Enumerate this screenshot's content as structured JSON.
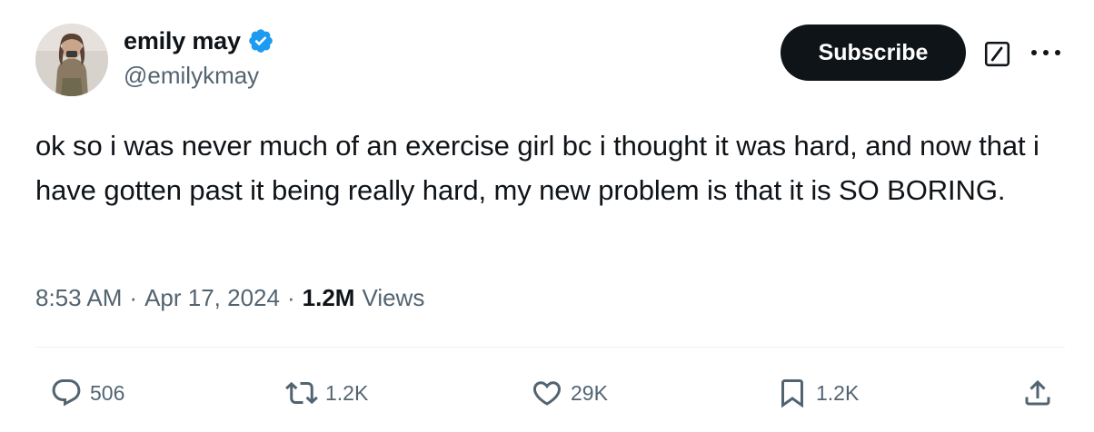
{
  "user": {
    "display_name": "emily may",
    "handle": "@emilykmay",
    "verified_icon": "verified-badge-icon",
    "avatar": "profile-photo"
  },
  "header_actions": {
    "subscribe_label": "Subscribe",
    "grok_icon": "grok-icon",
    "more_icon": "more-icon"
  },
  "tweet": {
    "text": "ok so i was never much of an exercise girl bc i thought it was hard, and now that i have gotten past it being really hard, my new problem is that it is SO BORING.",
    "time": "8:53 AM",
    "separator": "·",
    "date": "Apr 17, 2024",
    "views_count": "1.2M",
    "views_label": "Views"
  },
  "engagement": {
    "replies": "506",
    "reposts": "1.2K",
    "likes": "29K",
    "bookmarks": "1.2K"
  },
  "colors": {
    "primary_text": "#0f1419",
    "secondary_text": "#536471",
    "verified_blue": "#1d9bf0",
    "button_dark": "#0f1419",
    "divider": "#eff3f4"
  }
}
